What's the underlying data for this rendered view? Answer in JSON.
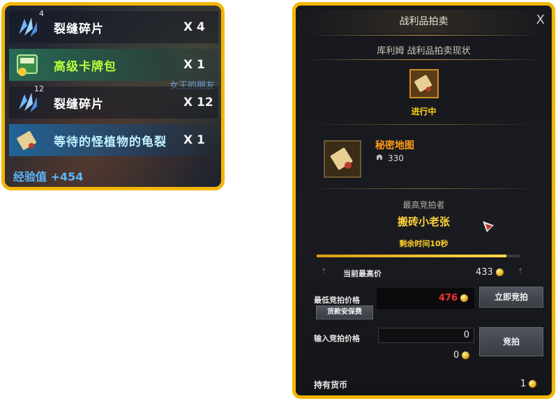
{
  "loot": {
    "items": [
      {
        "icon": "crystal-shard-icon",
        "count": "4",
        "name": "裂缝碎片",
        "qty": "X 4",
        "style": ""
      },
      {
        "icon": "card-pack-icon",
        "count": "",
        "name": "高级卡牌包",
        "qty": "X 1",
        "style": "hl"
      },
      {
        "icon": "crystal-shard-icon",
        "count": "12",
        "name": "裂缝碎片",
        "qty": "X 12",
        "style": ""
      },
      {
        "icon": "scroll-icon",
        "count": "",
        "name": "等待的怪植物的龟裂",
        "qty": "X 1",
        "style": "blue"
      }
    ],
    "exp": "经验值 +454",
    "bg_text": "女王的朋友"
  },
  "auction": {
    "title": "战利品拍卖",
    "close": "X",
    "subtitle": "库利姆 战利品拍卖现状",
    "status": "进行中",
    "item_name": "秘密地图",
    "item_power": "330",
    "bidder_label": "最高竞拍者",
    "bidder_name": "搬砖小老张",
    "remaining": "剩余时间10秒",
    "progress": 0.93,
    "current_label": "当前最高价",
    "current_value": "433",
    "min_label": "最低竞拍价格",
    "min_value": "476",
    "buy_now": "立即竞拍",
    "insurance": "货款安保费",
    "input_label": "输入竞拍价格",
    "input_value": "0",
    "input_total": "0",
    "bid": "竞拍",
    "hold_label": "持有货币",
    "hold_value": "1"
  },
  "colors": {
    "frame": "#f2b705",
    "gold_text": "#ffd23a",
    "item_orange": "#ff9a1a",
    "price_red": "#ff2f2f"
  }
}
